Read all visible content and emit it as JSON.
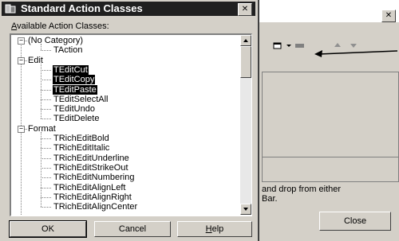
{
  "dialog": {
    "title": "Standard Action Classes",
    "close_glyph": "✕",
    "label_prefix": "A",
    "label_rest": "vailable Action Classes:",
    "tree": [
      {
        "label": "(No Category)",
        "level": 0,
        "expander": "−",
        "selected": false
      },
      {
        "label": "TAction",
        "level": 1,
        "selected": false
      },
      {
        "label": "Edit",
        "level": 0,
        "expander": "−",
        "selected": false
      },
      {
        "label": "TEditCut",
        "level": 1,
        "selected": true
      },
      {
        "label": "TEditCopy",
        "level": 1,
        "selected": true
      },
      {
        "label": "TEditPaste",
        "level": 1,
        "selected": true
      },
      {
        "label": "TEditSelectAll",
        "level": 1,
        "selected": false
      },
      {
        "label": "TEditUndo",
        "level": 1,
        "selected": false
      },
      {
        "label": "TEditDelete",
        "level": 1,
        "selected": false
      },
      {
        "label": "Format",
        "level": 0,
        "expander": "−",
        "selected": false
      },
      {
        "label": "TRichEditBold",
        "level": 1,
        "selected": false
      },
      {
        "label": "TRichEditItalic",
        "level": 1,
        "selected": false
      },
      {
        "label": "TRichEditUnderline",
        "level": 1,
        "selected": false
      },
      {
        "label": "TRichEditStrikeOut",
        "level": 1,
        "selected": false
      },
      {
        "label": "TRichEditNumbering",
        "level": 1,
        "selected": false
      },
      {
        "label": "TRichEditAlignLeft",
        "level": 1,
        "selected": false
      },
      {
        "label": "TRichEditAlignRight",
        "level": 1,
        "selected": false
      },
      {
        "label": "TRichEditAlignCenter",
        "level": 1,
        "selected": false
      }
    ],
    "buttons": {
      "ok": "OK",
      "cancel": "Cancel",
      "help_prefix": "H",
      "help_rest": "elp"
    }
  },
  "background_window": {
    "close_glyph": "✕",
    "hint_line1": "and drop from either",
    "hint_line2": "Bar.",
    "close_button": "Close"
  },
  "colors": {
    "selection_bg": "#000000",
    "titlebar_bg": "#202020",
    "face": "#d4d0c8"
  }
}
